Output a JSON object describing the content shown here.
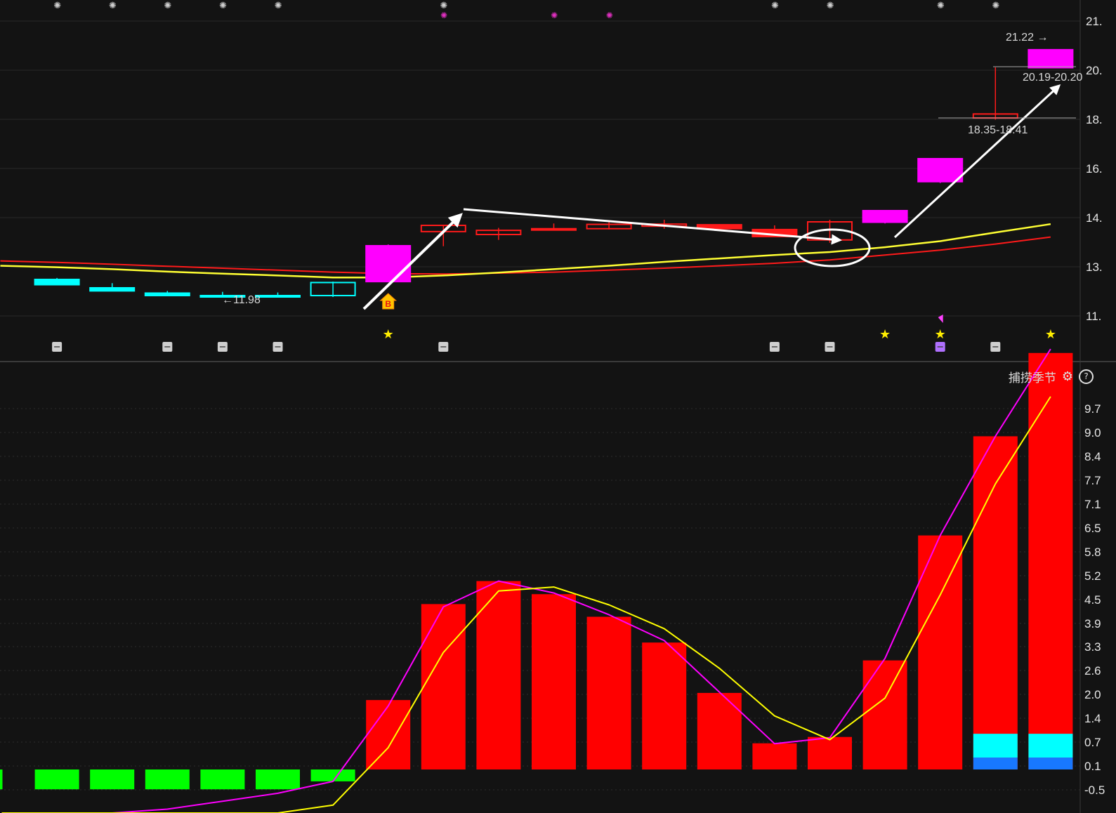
{
  "indicator": {
    "title": "捕捞季节",
    "help_glyph": "?"
  },
  "colors": {
    "background": "#131313",
    "candle_up": "#ff1a1a",
    "candle_down": "#00ffff",
    "limit_up_candle": "#ff00ff",
    "ma_short": "#ffff33",
    "ma_long": "#ff1a1a",
    "bar_positive": "#ff0000",
    "bar_negative": "#00ff00",
    "bar_cyan": "#00ffff",
    "bar_blue": "#1878ff",
    "line_fast": "#ff00ff",
    "line_slow": "#ffff00",
    "annotation": "#ffffff"
  },
  "chart_data": [
    {
      "type": "candlestick",
      "x": [
        1,
        2,
        3,
        4,
        5,
        6,
        7,
        8,
        9,
        10,
        11,
        12,
        13,
        14,
        15,
        16,
        17,
        18,
        19,
        20
      ],
      "candles": [
        {
          "open": 12.75,
          "high": 12.8,
          "low": 12.72,
          "close": 12.72,
          "style": "down-filled"
        },
        {
          "open": 12.72,
          "high": 12.75,
          "low": 12.55,
          "close": 12.55,
          "style": "down-filled"
        },
        {
          "open": 12.45,
          "high": 12.6,
          "low": 12.35,
          "close": 12.35,
          "style": "down-filled"
        },
        {
          "open": 12.28,
          "high": 12.35,
          "low": 12.18,
          "close": 12.2,
          "style": "down-filled"
        },
        {
          "open": 12.2,
          "high": 12.32,
          "low": 12.13,
          "close": 12.18,
          "style": "down-filled"
        },
        {
          "open": 12.2,
          "high": 12.3,
          "low": 12.15,
          "close": 12.17,
          "style": "down-filled"
        },
        {
          "open": 12.2,
          "high": 12.65,
          "low": 12.15,
          "close": 12.62,
          "style": "cyan-hollow"
        },
        {
          "open": 12.65,
          "high": 13.44,
          "low": 12.65,
          "close": 13.41,
          "style": "limit-up"
        },
        {
          "open": 13.75,
          "high": 13.95,
          "low": 13.4,
          "close": 13.9,
          "style": "up-hollow"
        },
        {
          "open": 13.68,
          "high": 13.84,
          "low": 13.55,
          "close": 13.78,
          "style": "up-hollow"
        },
        {
          "open": 13.8,
          "high": 14.05,
          "low": 13.78,
          "close": 13.82,
          "style": "up-hollow"
        },
        {
          "open": 13.82,
          "high": 14.15,
          "low": 13.8,
          "close": 13.98,
          "style": "up-hollow"
        },
        {
          "open": 13.88,
          "high": 14.35,
          "low": 13.82,
          "close": 14.0,
          "style": "up-hollow"
        },
        {
          "open": 13.95,
          "high": 14.0,
          "low": 13.82,
          "close": 13.82,
          "style": "up-filled"
        },
        {
          "open": 13.8,
          "high": 13.9,
          "low": 13.62,
          "close": 13.63,
          "style": "up-filled"
        },
        {
          "open": 13.55,
          "high": 14.35,
          "low": 13.48,
          "close": 14.18,
          "style": "up-hollow"
        },
        {
          "open": 14.15,
          "high": 15.08,
          "low": 14.05,
          "close": 15.08,
          "style": "limit-up"
        },
        {
          "open": 16.15,
          "high": 17.0,
          "low": 16.1,
          "close": 17.0,
          "style": "limit-up"
        },
        {
          "open": 18.41,
          "high": 20.19,
          "low": 18.35,
          "close": 18.55,
          "style": "up-hollow"
        },
        {
          "open": 20.18,
          "high": 20.78,
          "low": 20.18,
          "close": 20.78,
          "style": "limit-up"
        }
      ],
      "ma_short": [
        13.0,
        12.97,
        12.93,
        12.88,
        12.84,
        12.8,
        12.76,
        12.76,
        12.8,
        12.86,
        12.93,
        13.0,
        13.08,
        13.15,
        13.22,
        13.28,
        13.38,
        13.52,
        13.73,
        14.0
      ],
      "ma_long": [
        13.1,
        13.07,
        13.03,
        12.99,
        12.95,
        12.91,
        12.87,
        12.84,
        12.83,
        12.85,
        12.87,
        12.91,
        12.95,
        13.0,
        13.05,
        13.12,
        13.22,
        13.32,
        13.45,
        13.62
      ],
      "y_ticks": [
        "21.",
        "20.",
        "18.",
        "16.",
        "14.",
        "13.",
        "11."
      ],
      "annotations": [
        "21.22",
        "20.19-20.20",
        "18.35-18.41",
        "←11.98",
        "B"
      ]
    },
    {
      "type": "bar",
      "title": "捕捞季节",
      "x": [
        1,
        2,
        3,
        4,
        5,
        6,
        7,
        8,
        9,
        10,
        11,
        12,
        13,
        14,
        15,
        16,
        17,
        18,
        19,
        20
      ],
      "values": [
        -0.5,
        -0.5,
        -0.5,
        -0.5,
        -0.5,
        -0.5,
        -0.3,
        1.75,
        4.17,
        4.75,
        4.42,
        3.85,
        3.2,
        1.93,
        0.66,
        0.82,
        2.75,
        5.9,
        8.4,
        10.5
      ],
      "cyan_segment": [
        0,
        0,
        0,
        0,
        0,
        0,
        0,
        0,
        0,
        0,
        0,
        0,
        0,
        0,
        0,
        0,
        0,
        0,
        0.6,
        0.6
      ],
      "blue_segment": [
        0,
        0,
        0,
        0,
        0,
        0,
        0,
        0,
        0,
        0,
        0,
        0,
        0,
        0,
        0,
        0,
        0,
        0,
        0.3,
        0.3
      ],
      "series": [
        {
          "values": [
            -1.6,
            -1.4,
            -1.2,
            -1.0,
            -0.8,
            -0.6,
            -0.3,
            1.6,
            4.1,
            4.75,
            4.45,
            3.9,
            3.25,
            1.95,
            0.65,
            0.8,
            2.8,
            5.9,
            8.4,
            10.6
          ]
        },
        {
          "values": [
            -2.2,
            -2.0,
            -1.8,
            -1.6,
            -1.4,
            -1.2,
            -0.9,
            0.55,
            2.95,
            4.5,
            4.6,
            4.15,
            3.55,
            2.55,
            1.35,
            0.75,
            1.8,
            4.4,
            7.2,
            9.4
          ]
        }
      ],
      "y_ticks": [
        "9.7",
        "9.0",
        "8.4",
        "7.7",
        "7.1",
        "6.5",
        "5.8",
        "5.2",
        "4.5",
        "3.9",
        "3.3",
        "2.6",
        "2.0",
        "1.4",
        "0.7",
        "0.1",
        "-0.5"
      ]
    }
  ]
}
